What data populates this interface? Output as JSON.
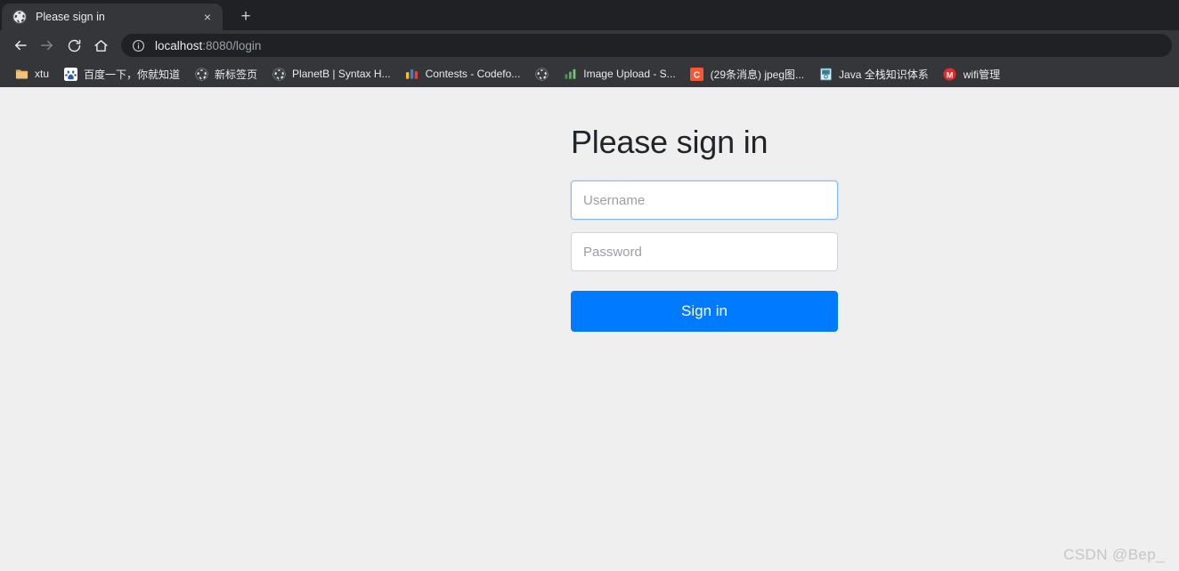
{
  "browser": {
    "tab": {
      "title": "Please sign in",
      "favicon": "globe-icon",
      "close_label": "×"
    },
    "newtab_label": "+",
    "toolbar": {
      "back": "back-arrow-icon",
      "forward": "forward-arrow-icon",
      "reload": "reload-icon",
      "home": "home-icon"
    },
    "omnibox": {
      "info_icon": "info-circle-icon",
      "host": "localhost",
      "path": ":8080/login",
      "full_url": "localhost:8080/login"
    },
    "bookmarks": [
      {
        "label": "xtu",
        "icon": "folder-icon"
      },
      {
        "label": "百度一下，你就知道",
        "icon": "baidu-paw-icon"
      },
      {
        "label": "新标签页",
        "icon": "globe-icon"
      },
      {
        "label": "PlanetB | Syntax H...",
        "icon": "globe-icon"
      },
      {
        "label": "Contests - Codefo...",
        "icon": "codeforces-bars-icon"
      },
      {
        "label": "",
        "icon": "globe-icon"
      },
      {
        "label": "Image Upload - S...",
        "icon": "green-bars-icon"
      },
      {
        "label": "(29条消息) jpeg图...",
        "icon": "csdn-c-icon"
      },
      {
        "label": "Java 全栈知识体系",
        "icon": "book-icon"
      },
      {
        "label": "wifi管理",
        "icon": "red-m-icon"
      }
    ]
  },
  "page": {
    "title": "Please sign in",
    "username": {
      "placeholder": "Username",
      "value": ""
    },
    "password": {
      "placeholder": "Password",
      "value": ""
    },
    "submit_label": "Sign in",
    "watermark": "CSDN @Bep_"
  },
  "colors": {
    "accent": "#007bff",
    "focus_border": "#80bdff",
    "page_background": "#efefef",
    "chrome_toolbar": "#35363a",
    "chrome_tabstrip": "#202124",
    "heading": "#212529"
  }
}
